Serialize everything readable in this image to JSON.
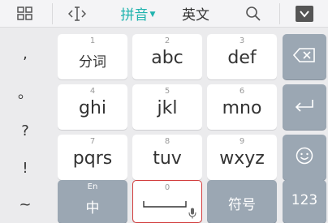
{
  "toolbar": {
    "pinyin_label": "拼音",
    "english_label": "英文"
  },
  "side_punctuation": [
    ",",
    "。",
    "?",
    "!",
    "~"
  ],
  "keys": {
    "k1": {
      "num": "1",
      "label": "分词"
    },
    "k2": {
      "num": "2",
      "label": "abc"
    },
    "k3": {
      "num": "3",
      "label": "def"
    },
    "k4": {
      "num": "4",
      "label": "ghi"
    },
    "k5": {
      "num": "5",
      "label": "jkl"
    },
    "k6": {
      "num": "6",
      "label": "mno"
    },
    "k7": {
      "num": "7",
      "label": "pqrs"
    },
    "k8": {
      "num": "8",
      "label": "tuv"
    },
    "k9": {
      "num": "9",
      "label": "wxyz"
    },
    "lang": {
      "sub": "En",
      "label": "中"
    },
    "space": {
      "num": "0"
    },
    "symbol": {
      "label": "符号"
    },
    "num123": {
      "label": "123"
    }
  },
  "colors": {
    "accent": "#20b3ae",
    "dark_key": "#9ba7b3",
    "background": "#ebebed"
  }
}
